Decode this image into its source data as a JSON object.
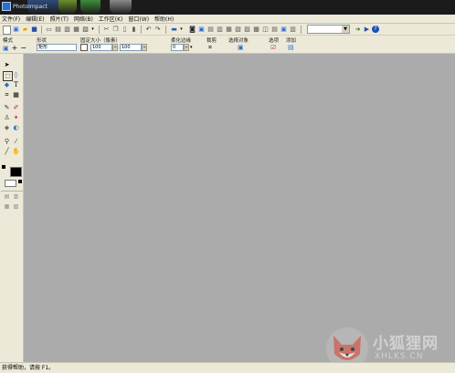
{
  "window": {
    "title": "PhotoImpact"
  },
  "menu": [
    {
      "label": "文件(F)"
    },
    {
      "label": "编辑(E)"
    },
    {
      "label": "照片(T)"
    },
    {
      "label": "网络(B)"
    },
    {
      "label": "工作区(K)"
    },
    {
      "label": "窗口(W)"
    },
    {
      "label": "帮助(H)"
    }
  ],
  "toolbar": {
    "zoom_value": ""
  },
  "attrbar": {
    "mode_label": "模式",
    "shape_label": "形状",
    "shape_value": "矩形",
    "fixed_size_label": "固定大小（像素）",
    "width_value": "100",
    "height_value": "100",
    "soft_edge_label": "柔化边缘",
    "soft_edge_value": "0",
    "crop_label": "裁剪",
    "select_object_label": "选择对象",
    "options_label": "选项",
    "add_label": "添加"
  },
  "status": {
    "text": "获得帮助，请按 F1。"
  },
  "watermark": {
    "cn": "小狐狸网",
    "en": "XHLKS.CN"
  },
  "colors": {
    "workspace": "#ababab",
    "chrome": "#ece9d8",
    "taskbar": "#1b1b1b"
  }
}
